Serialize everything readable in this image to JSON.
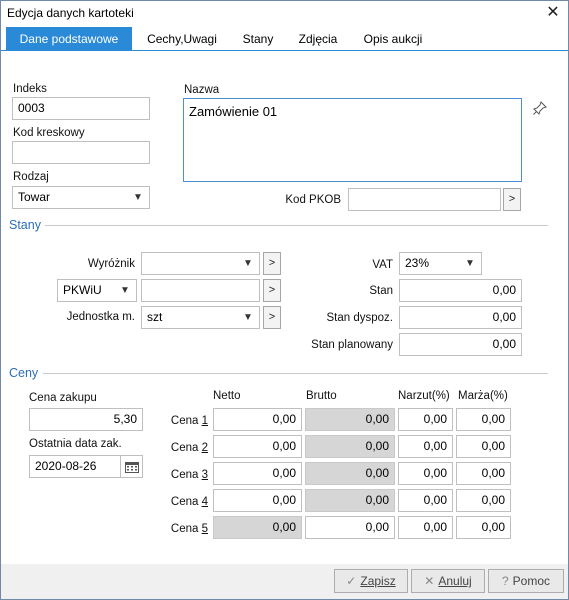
{
  "window": {
    "title": "Edycja danych kartoteki",
    "close_glyph": "✕"
  },
  "tabs": [
    {
      "label": "Dane podstawowe",
      "active": true
    },
    {
      "label": "Cechy,Uwagi",
      "active": false
    },
    {
      "label": "Stany",
      "active": false
    },
    {
      "label": "Zdjęcia",
      "active": false
    },
    {
      "label": "Opis aukcji",
      "active": false
    }
  ],
  "basic": {
    "indeks_label": "Indeks",
    "indeks_value": "0003",
    "kod_kreskowy_label": "Kod kreskowy",
    "kod_kreskowy_value": "",
    "rodzaj_label": "Rodzaj",
    "rodzaj_value": "Towar",
    "nazwa_label": "Nazwa",
    "nazwa_value": "Zamówienie 01",
    "pin_icon": "pin-icon",
    "kod_pkob_label": "Kod PKOB",
    "kod_pkob_value": ""
  },
  "stany": {
    "section_title": "Stany",
    "wyroznik_label": "Wyróżnik",
    "wyroznik_value": "",
    "pkwiu_select": "PKWiU",
    "pkwiu_value": "",
    "jednostka_label": "Jednostka m.",
    "jednostka_value": "szt",
    "vat_label": "VAT",
    "vat_value": "23%",
    "stan_label": "Stan",
    "stan_value": "0,00",
    "stan_dyspoz_label": "Stan dyspoz.",
    "stan_dyspoz_value": "0,00",
    "stan_planowany_label": "Stan planowany",
    "stan_planowany_value": "0,00"
  },
  "ceny": {
    "section_title": "Ceny",
    "cena_zakupu_label": "Cena zakupu",
    "cena_zakupu_value": "5,30",
    "ostatnia_data_label": "Ostatnia data zak.",
    "ostatnia_data_value": "2020-08-26",
    "columns": [
      "Netto",
      "Brutto",
      "Narzut(%)",
      "Marża(%)"
    ],
    "rows": [
      {
        "label_prefix": "Cena ",
        "label_num": "1",
        "netto": "0,00",
        "brutto": "0,00",
        "narzut": "0,00",
        "marza": "0,00"
      },
      {
        "label_prefix": "Cena ",
        "label_num": "2",
        "netto": "0,00",
        "brutto": "0,00",
        "narzut": "0,00",
        "marza": "0,00"
      },
      {
        "label_prefix": "Cena ",
        "label_num": "3",
        "netto": "0,00",
        "brutto": "0,00",
        "narzut": "0,00",
        "marza": "0,00"
      },
      {
        "label_prefix": "Cena ",
        "label_num": "4",
        "netto": "0,00",
        "brutto": "0,00",
        "narzut": "0,00",
        "marza": "0,00"
      },
      {
        "label_prefix": "Cena ",
        "label_num": "5",
        "netto": "0,00",
        "brutto": "0,00",
        "narzut": "0,00",
        "marza": "0,00"
      }
    ]
  },
  "footer": {
    "save_label": "Zapisz",
    "cancel_label": "Anuluj",
    "help_label": "Pomoc"
  },
  "colors": {
    "accent": "#2b8ad8",
    "section": "#2d6fb8",
    "disabled_field": "#d6d6d6"
  }
}
